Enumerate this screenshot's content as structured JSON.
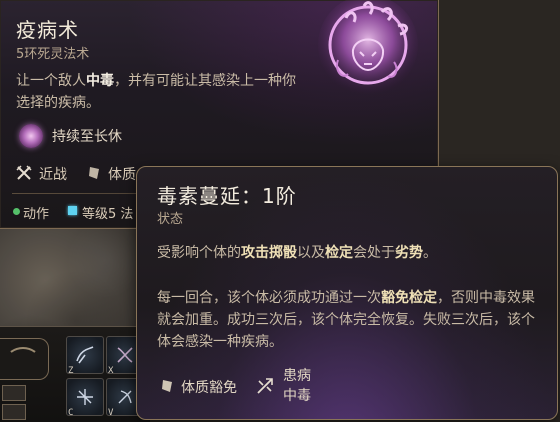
{
  "spell": {
    "title": "疫病术",
    "subtitle": "5环死灵法术",
    "description": {
      "part1": "让一个敌人",
      "highlight": "中毒",
      "part2": "，并有可能让其感染上一种你选择的疾病。"
    },
    "duration_icon": "sparkle-orb-icon",
    "duration": "持续至长休",
    "range_icon": "crossed-swords-icon",
    "range": "近战",
    "save_icon": "shield-stone-icon",
    "save_partial": "体质",
    "action_label": "动作",
    "level_partial": "等级5 法"
  },
  "condition": {
    "title": "毒素蔓延：1阶",
    "subtitle": "状态",
    "p1": {
      "part1": "受影响个体的",
      "hl1": "攻击掷骰",
      "part2": "以及",
      "hl2": "检定",
      "part3": "会处于",
      "hl3": "劣势",
      "part4": "。"
    },
    "p2": {
      "part1": "每一回合，该个体必须成功通过一次",
      "hl1": "豁免检定",
      "part2": "，否则中毒效果就会加重。成功三次后，该个体完全恢复。失败三次后，该个体会感染一种疾病。"
    },
    "save_icon": "shield-stone-icon",
    "save_label": "体质豁免",
    "effect_icon": "broken-arrow-icon",
    "effect_line1": "患病",
    "effect_line2": "中毒"
  },
  "hotbar": {
    "keys": [
      "Z",
      "X",
      "C",
      "V"
    ]
  },
  "colors": {
    "border_gold": "#8a7558",
    "highlight": "#efe0b6",
    "action_green": "#55c06a",
    "level_cyan": "#5ed2f0",
    "necro_purple": "#b56fbc"
  }
}
